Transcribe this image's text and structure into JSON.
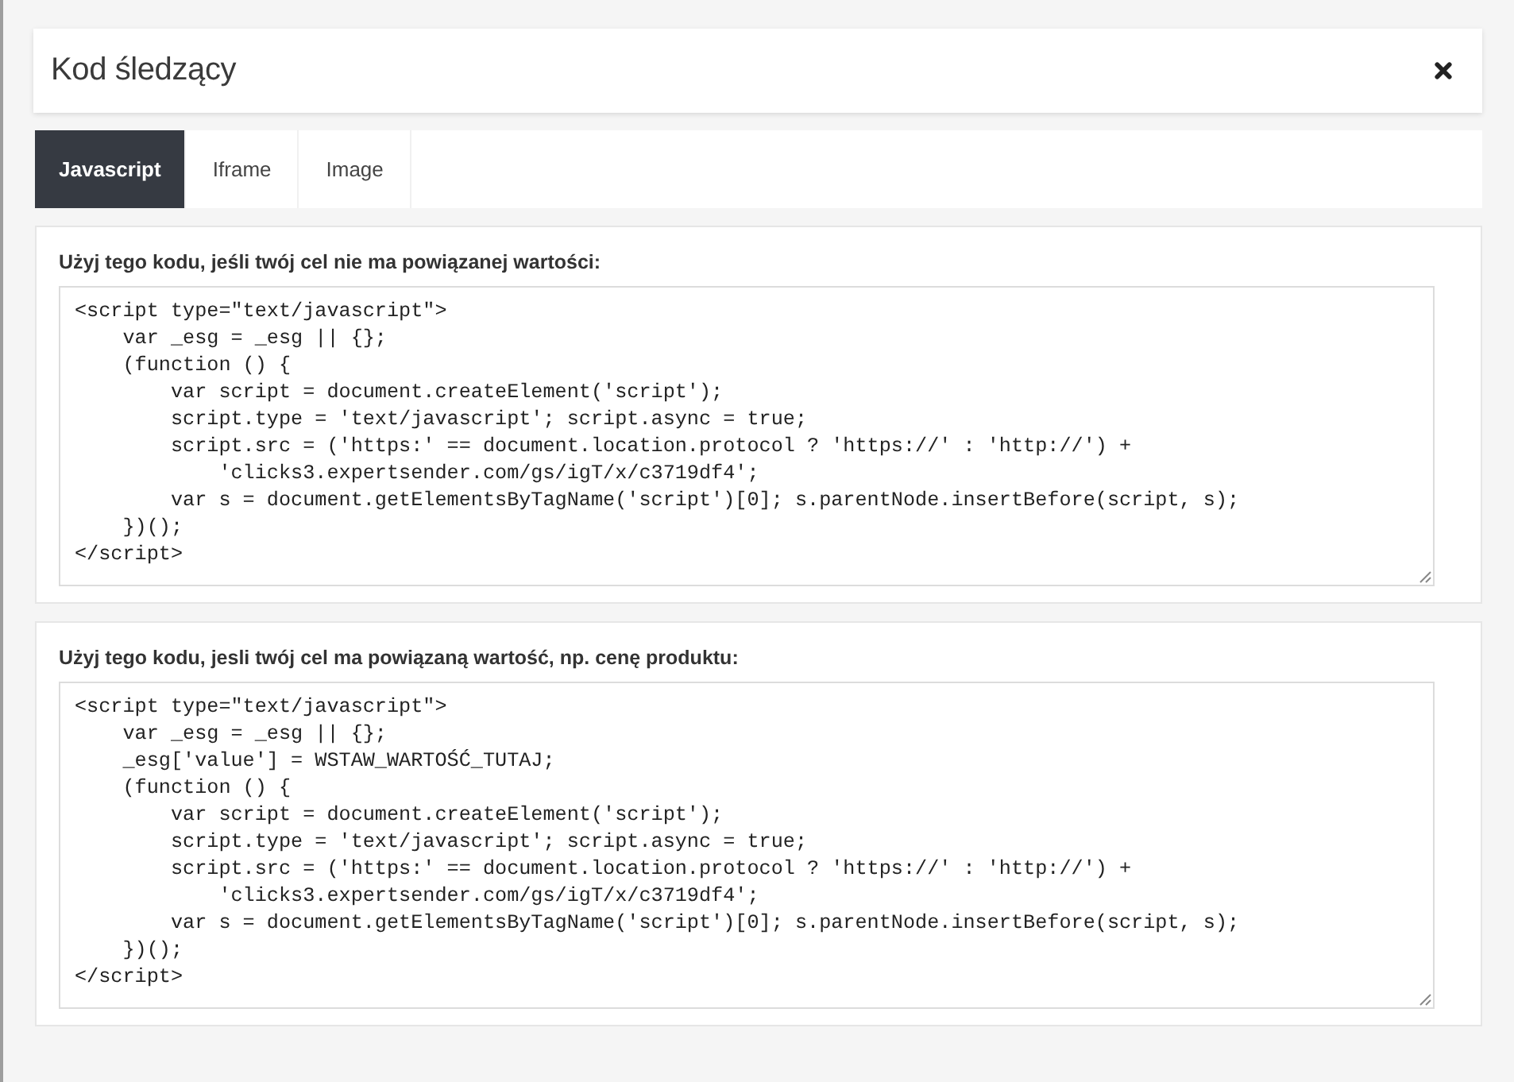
{
  "dialog": {
    "title": "Kod śledzący"
  },
  "tabs": [
    {
      "label": "Javascript",
      "selected": true
    },
    {
      "label": "Iframe",
      "selected": false
    },
    {
      "label": "Image",
      "selected": false
    }
  ],
  "sections": [
    {
      "label": "Użyj tego kodu, jeśli twój cel nie ma powiązanej wartości:",
      "code": "<script type=\"text/javascript\">\n    var _esg = _esg || {};\n    (function () {\n        var script = document.createElement('script');\n        script.type = 'text/javascript'; script.async = true;\n        script.src = ('https:' == document.location.protocol ? 'https://' : 'http://') +\n            'clicks3.expertsender.com/gs/igT/x/c3719df4';\n        var s = document.getElementsByTagName('script')[0]; s.parentNode.insertBefore(script, s);\n    })();\n</script>"
    },
    {
      "label": "Użyj tego kodu, jesli twój cel ma powiązaną wartość, np. cenę produktu:",
      "code": "<script type=\"text/javascript\">\n    var _esg = _esg || {};\n    _esg['value'] = WSTAW_WARTOŚĆ_TUTAJ;\n    (function () {\n        var script = document.createElement('script');\n        script.type = 'text/javascript'; script.async = true;\n        script.src = ('https:' == document.location.protocol ? 'https://' : 'http://') +\n            'clicks3.expertsender.com/gs/igT/x/c3719df4';\n        var s = document.getElementsByTagName('script')[0]; s.parentNode.insertBefore(script, s);\n    })();\n</script>"
    }
  ]
}
